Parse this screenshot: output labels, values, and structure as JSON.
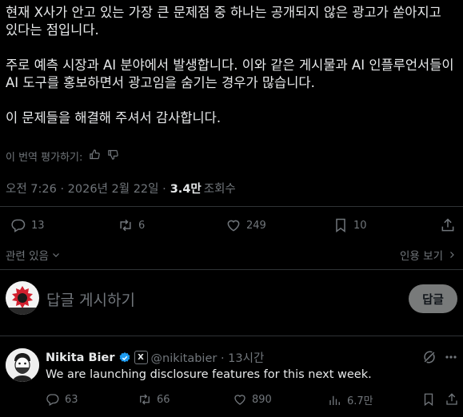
{
  "post": {
    "paragraphs": [
      "현재 X사가 안고 있는 가장 큰 문제점 중 하나는 공개되지 않은 광고가 쏟아지고 있다는 점입니다.",
      "주로 예측 시장과 AI 분야에서 발생합니다. 이와 같은 게시물과 AI 인플루언서들이 AI 도구를 홍보하면서 광고임을 숨기는 경우가 많습니다.",
      "이 문제들을 해결해 주셔서 감사합니다."
    ],
    "translate_label": "이 번역 평가하기:",
    "time": "오전 7:26 · 2026년 2월 22일 ·",
    "views": "3.4만",
    "views_label": "조회수"
  },
  "actions": {
    "replies": "13",
    "reposts": "6",
    "likes": "249",
    "bookmarks": "10"
  },
  "related_label": "관련 있음",
  "quotes_label": "인용 보기",
  "composer": {
    "placeholder": "답글 게시하기",
    "button": "답글"
  },
  "reply": {
    "name": "Nikita Bier",
    "affiliate_badge": "X",
    "handle": "@nikitabier · 13시간",
    "text": "We are launching disclosure features for this next week.",
    "replies": "63",
    "reposts": "66",
    "likes": "890",
    "views": "6.7만"
  },
  "icons": [
    "thumbs-up-icon",
    "thumbs-down-icon",
    "reply-icon",
    "repost-icon",
    "like-icon",
    "bookmark-icon",
    "share-icon",
    "chevron-down-icon",
    "chevron-right-icon",
    "verified-badge-icon",
    "grok-icon",
    "more-icon",
    "views-icon"
  ],
  "colors": {
    "background": "#000000",
    "text": "#e7e9ea",
    "muted": "#71767b",
    "verified": "#1d9bf0",
    "button": "#787a7a"
  }
}
